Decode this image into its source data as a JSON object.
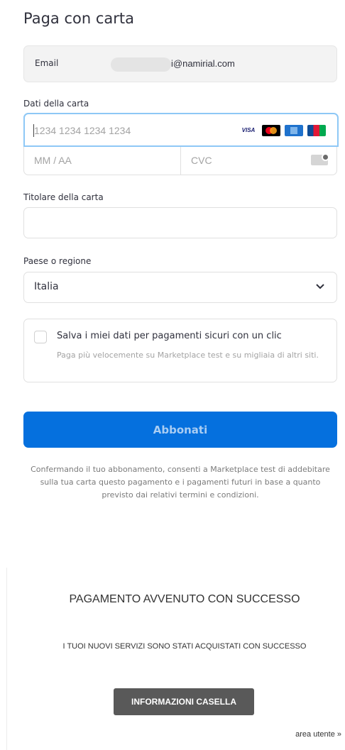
{
  "payment_form": {
    "title": "Paga con carta",
    "email": {
      "label": "Email",
      "value": "i@namirial.com"
    },
    "card": {
      "section_label": "Dati della carta",
      "number_placeholder": "1234 1234 1234 1234",
      "expiry_placeholder": "MM / AA",
      "cvc_placeholder": "CVC",
      "brand_visa": "VISA",
      "brands": [
        "visa-icon",
        "mastercard-icon",
        "amex-icon",
        "jcb-icon"
      ]
    },
    "cardholder": {
      "label": "Titolare della carta",
      "value": ""
    },
    "country": {
      "label": "Paese o regione",
      "selected": "Italia"
    },
    "save": {
      "title": "Salva i miei dati per pagamenti sicuri con un clic",
      "description": "Paga più velocemente su Marketplace test e su migliaia di altri siti.",
      "checked": false
    },
    "submit_label": "Abbonati",
    "terms": "Confermando il tuo abbonamento, consenti a Marketplace test di addebitare sulla tua carta questo pagamento e i pagamenti futuri in base a quanto previsto dai relativi termini e condizioni."
  },
  "success": {
    "title": "PAGAMENTO AVVENUTO CON SUCCESSO",
    "message": "I TUOI NUOVI SERVIZI SONO STATI ACQUISTATI CON SUCCESSO",
    "button_label": "INFORMAZIONI CASELLA",
    "link_label": "area utente »"
  },
  "colors": {
    "primary": "#0570de",
    "focus_border": "#8ec8f6",
    "dark_button": "#595959"
  }
}
